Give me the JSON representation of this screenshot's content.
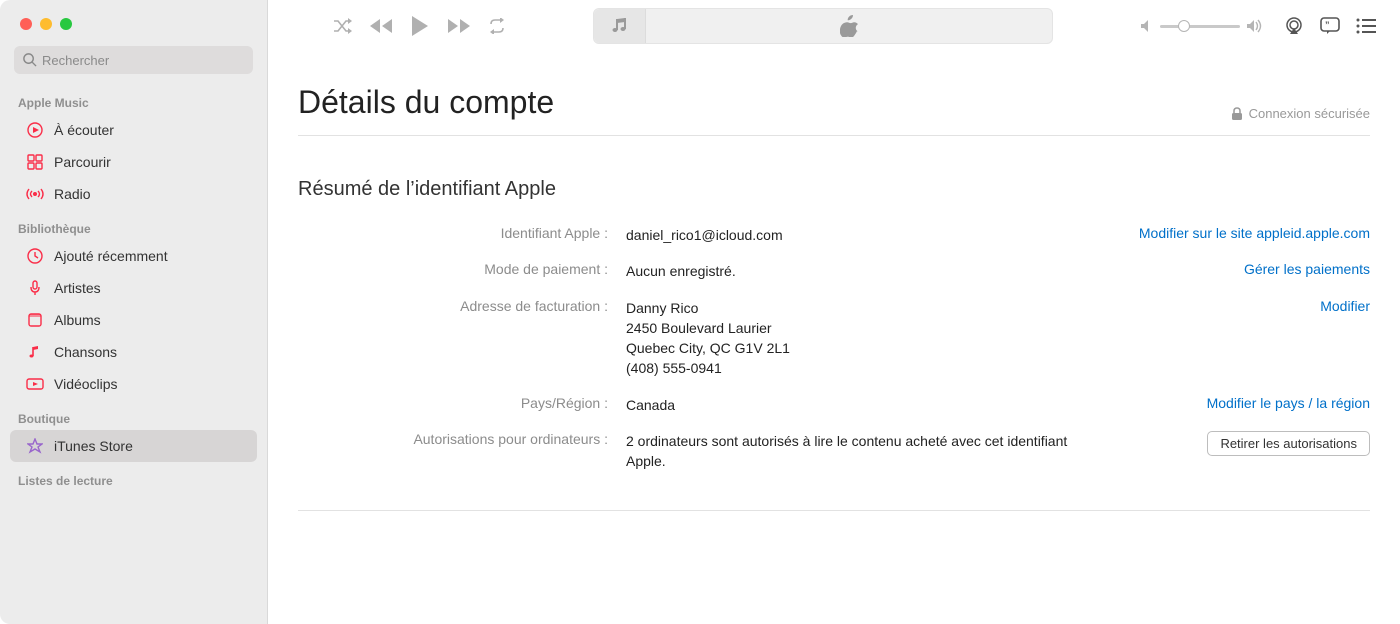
{
  "search": {
    "placeholder": "Rechercher"
  },
  "sidebar": {
    "sections": {
      "apple_music": {
        "label": "Apple Music",
        "items": [
          {
            "label": "À écouter"
          },
          {
            "label": "Parcourir"
          },
          {
            "label": "Radio"
          }
        ]
      },
      "library": {
        "label": "Bibliothèque",
        "items": [
          {
            "label": "Ajouté récemment"
          },
          {
            "label": "Artistes"
          },
          {
            "label": "Albums"
          },
          {
            "label": "Chansons"
          },
          {
            "label": "Vidéoclips"
          }
        ]
      },
      "store": {
        "label": "Boutique",
        "items": [
          {
            "label": "iTunes Store"
          }
        ]
      },
      "playlists": {
        "label": "Listes de lecture"
      }
    }
  },
  "page": {
    "title": "Détails du compte",
    "secure_label": "Connexion sécurisée",
    "section_title": "Résumé de l’identifiant Apple"
  },
  "rows": {
    "apple_id": {
      "label": "Identifiant Apple :",
      "value": "daniel_rico1@icloud.com",
      "action": "Modifier sur le site appleid.apple.com"
    },
    "payment": {
      "label": "Mode de paiement :",
      "value": "Aucun enregistré.",
      "action": "Gérer les paiements"
    },
    "billing": {
      "label": "Adresse de facturation :",
      "name": "Danny Rico",
      "line1": "2450 Boulevard Laurier",
      "line2": "Quebec City, QC G1V 2L1",
      "phone": "(408) 555-0941",
      "action": "Modifier"
    },
    "country": {
      "label": "Pays/Région :",
      "value": "Canada",
      "action": "Modifier le pays / la région"
    },
    "auth": {
      "label": "Autorisations pour ordinateurs :",
      "value": "2 ordinateurs sont autorisés à lire le contenu acheté avec cet identifiant Apple.",
      "button": "Retirer les autorisations"
    }
  }
}
